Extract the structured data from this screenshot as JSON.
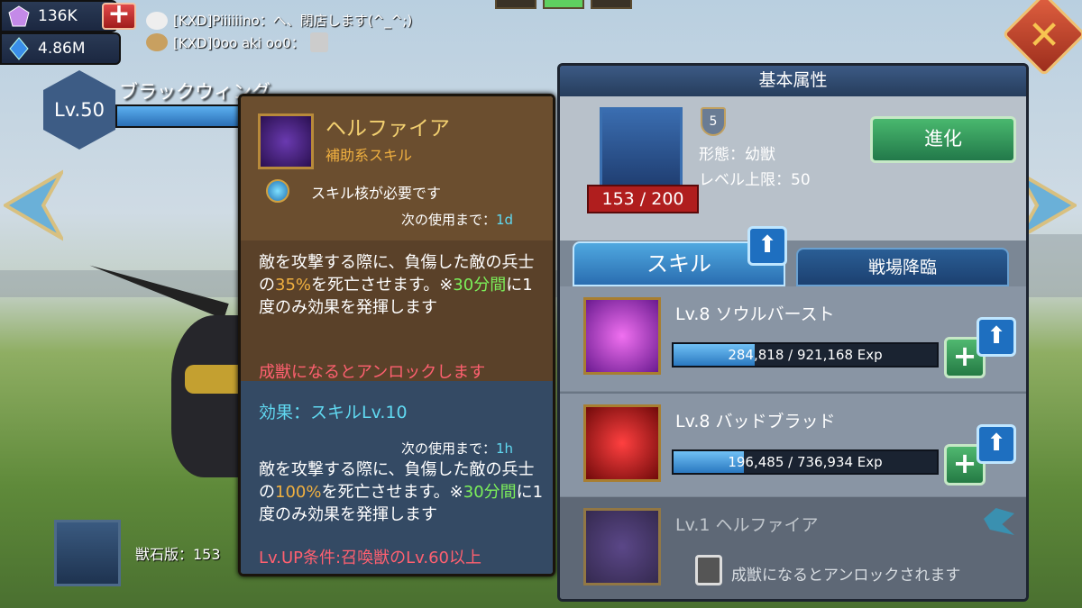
{
  "currency": {
    "gems": "136K",
    "crystal": "4.86M"
  },
  "chat": [
    {
      "text": "[KXD]Piiiiiino：へ、閉店します(^_^;)"
    },
    {
      "text": "[KXD]0oo aki oo0："
    }
  ],
  "familiar": {
    "level": "Lv.50",
    "name": "ブラックウィング",
    "stone_label": "獣石版：153"
  },
  "tooltip": {
    "title": "ヘルファイア",
    "subtitle": "補助系スキル",
    "core_req": "スキル核が必要です",
    "cooldown_label": "次の使用まで：",
    "cooldown1": "1d",
    "desc1_a": "敵を攻撃する際に、負傷した敵の兵士の",
    "desc1_pct": "35%",
    "desc1_b": "を死亡させます。※",
    "desc1_time": "30分間",
    "desc1_c": "に1度のみ効果を発揮します",
    "unlock": "成獣になるとアンロックします",
    "effect": "効果：スキルLv.10",
    "cooldown2": "1h",
    "desc2_a": "敵を攻撃する際に、負傷した敵の兵士の",
    "desc2_pct": "100%",
    "desc2_b": "を死亡させます。",
    "desc2_c": "※",
    "desc2_time": "30分間",
    "desc2_d": "に1度のみ効果を発揮します",
    "levelup": "Lv.UP条件:召喚獣のLv.60以上"
  },
  "panel": {
    "header": "基本属性",
    "tier": "5",
    "form": "形態：幼獣",
    "level_cap": "レベル上限：50",
    "count": "153 / 200",
    "evolve": "進化",
    "tab_skill": "スキル",
    "tab_battle": "戦場降臨"
  },
  "skills": [
    {
      "name": "Lv.8 ソウルバースト",
      "exp": "284,818 / 921,168 Exp",
      "progress": 0.309
    },
    {
      "name": "Lv.8 バッドブラッド",
      "exp": "196,485 / 736,934 Exp",
      "progress": 0.267
    },
    {
      "name": "Lv.1 ヘルファイア",
      "locked": "成獣になるとアンロックされます"
    }
  ],
  "colors": {
    "accent_gold": "#f0b040",
    "green": "#7cf05a",
    "red": "#ff6070",
    "cyan": "#60d8f0"
  }
}
